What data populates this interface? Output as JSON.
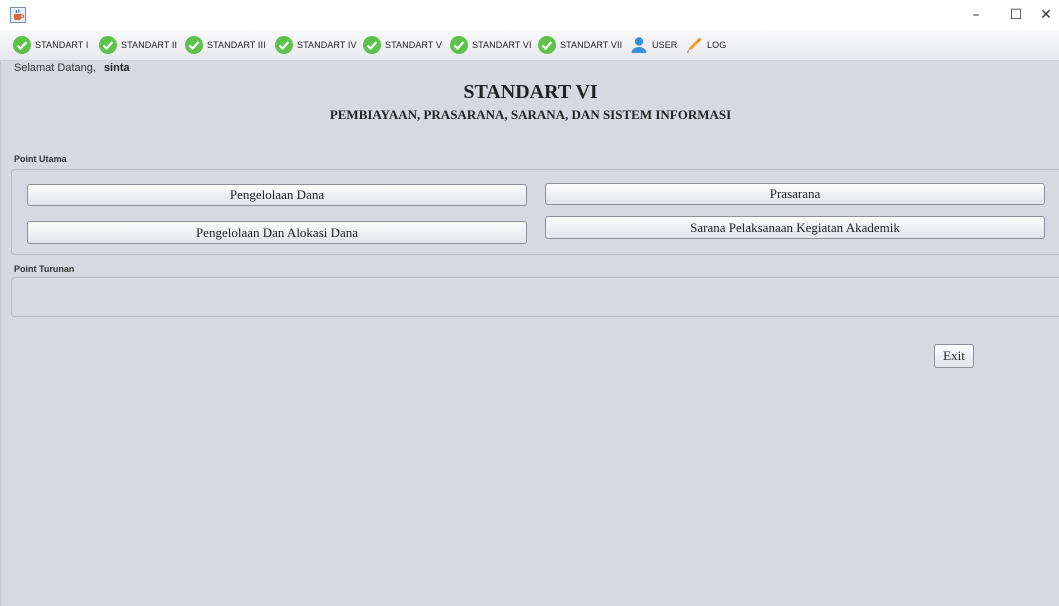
{
  "window": {
    "icon": "java-cup-icon",
    "controls": {
      "minimize": "–",
      "maximize": "☐",
      "close": "✕"
    }
  },
  "menu": {
    "items": [
      {
        "label": "STANDART I",
        "icon": "check-circle-icon"
      },
      {
        "label": "STANDART II",
        "icon": "check-circle-icon"
      },
      {
        "label": "STANDART III",
        "icon": "check-circle-icon"
      },
      {
        "label": "STANDART IV",
        "icon": "check-circle-icon"
      },
      {
        "label": "STANDART V",
        "icon": "check-circle-icon"
      },
      {
        "label": "STANDART VI",
        "icon": "check-circle-icon"
      },
      {
        "label": "STANDART VII",
        "icon": "check-circle-icon"
      },
      {
        "label": "USER",
        "icon": "user-icon"
      },
      {
        "label": "LOG",
        "icon": "pencil-icon"
      }
    ]
  },
  "welcome": {
    "text": "Selamat Datang,",
    "user": "sinta"
  },
  "page": {
    "title": "STANDART VI",
    "subtitle": "PEMBIAYAAN, PRASARANA, SARANA, DAN SISTEM INFORMASI"
  },
  "sections": {
    "utama_label": "Point Utama",
    "turunan_label": "Point Turunan"
  },
  "buttons": {
    "pengelolaan_dana": "Pengelolaan Dana",
    "pengelolaan_alokasi": "Pengelolaan Dan Alokasi Dana",
    "prasarana": "Prasarana",
    "sarana": "Sarana Pelaksanaan Kegiatan Akademik",
    "exit": "Exit"
  },
  "colors": {
    "content_bg": "#d6d9df",
    "check_green": "#5cc24a",
    "user_blue": "#3a8fd9",
    "pencil_orange": "#f0a020"
  }
}
